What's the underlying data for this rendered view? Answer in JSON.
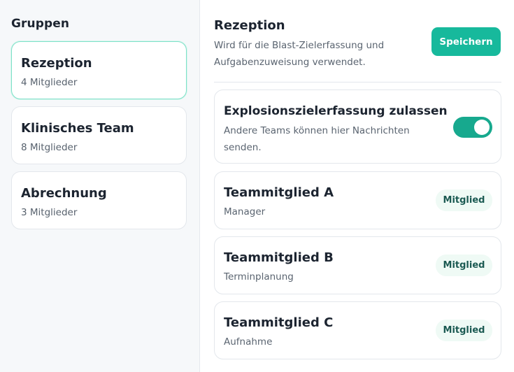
{
  "sidebar": {
    "title": "Gruppen",
    "groups": [
      {
        "name": "Rezeption",
        "count": "4 Mitglieder",
        "active": true
      },
      {
        "name": "Klinisches Team",
        "count": "8 Mitglieder",
        "active": false
      },
      {
        "name": "Abrechnung",
        "count": "3 Mitglieder",
        "active": false
      }
    ]
  },
  "main": {
    "title": "Rezeption",
    "description": "Wird für die Blast-Zielerfassung und Aufgabenzuweisung verwendet.",
    "save_label": "Speichern",
    "setting": {
      "title": "Explosionszielerfassung zulassen",
      "description": "Andere Teams können hier Nachrichten senden.",
      "enabled": true
    },
    "members": [
      {
        "name": "Teammitglied A",
        "role": "Manager",
        "badge": "Mitglied"
      },
      {
        "name": "Teammitglied B",
        "role": "Terminplanung",
        "badge": "Mitglied"
      },
      {
        "name": "Teammitglied C",
        "role": "Aufnahme",
        "badge": "Mitglied"
      }
    ]
  },
  "colors": {
    "accent": "#17b99c",
    "toggle_on": "#17a98e",
    "active_border": "#7fe0c9",
    "badge_bg": "#effaf5",
    "badge_text": "#1b5a52"
  }
}
